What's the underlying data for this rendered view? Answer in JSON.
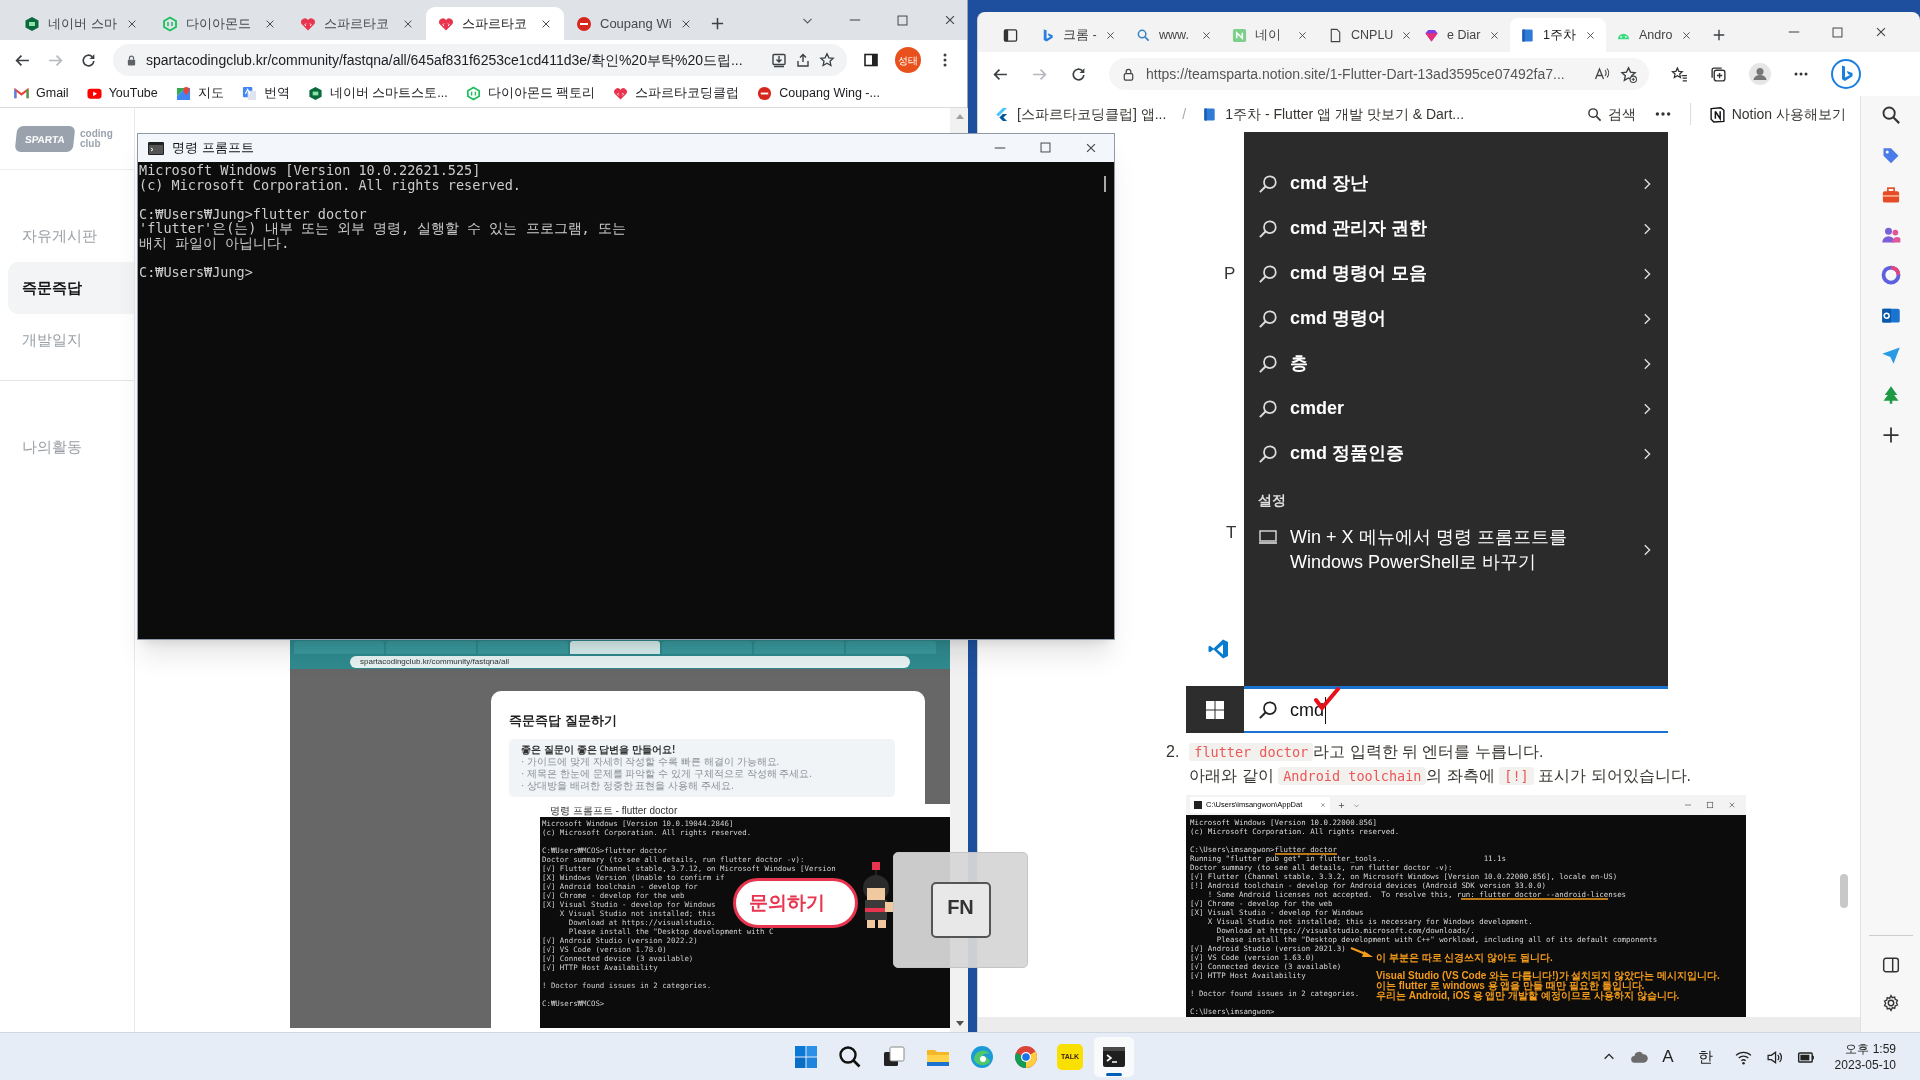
{
  "left_browser": {
    "tabs": [
      {
        "kind": "hexagon",
        "label": "네이버 스마",
        "selected": false
      },
      {
        "kind": "outline",
        "label": "다이아몬드",
        "selected": false
      },
      {
        "kind": "heart",
        "label": "스파르타코",
        "selected": false
      },
      {
        "kind": "heart",
        "label": "스파르타코",
        "selected": true
      },
      {
        "kind": "circle",
        "label": "Coupang Wi",
        "selected": false
      }
    ],
    "url": "spartacodingclub.kr/community/fastqna/all/645af831f6253ce1cd411d3e/확인%20부탁%20드립...",
    "profile": "성태",
    "bookmarks": [
      {
        "kind": "mail",
        "label": "Gmail"
      },
      {
        "kind": "play",
        "label": "YouTube"
      },
      {
        "kind": "pin",
        "label": "지도"
      },
      {
        "kind": "translate",
        "label": "번역"
      },
      {
        "kind": "hexagon",
        "label": "네이버 스마트스토..."
      },
      {
        "kind": "outline",
        "label": "다이아몬드 팩토리"
      },
      {
        "kind": "heart",
        "label": "스파르타코딩클럽"
      },
      {
        "kind": "circle",
        "label": "Coupang Wing -..."
      }
    ],
    "logo": {
      "mark": "SPARTA",
      "wordmark": "coding\nclub"
    },
    "nav": [
      {
        "label": "자유게시판",
        "selected": false
      },
      {
        "label": "즉문즉답",
        "selected": true
      },
      {
        "label": "개발일지",
        "selected": false
      },
      {
        "label": "나의활동",
        "selected": false
      }
    ],
    "post_image": {
      "url": "spartacodingclub.kr/community/fastqna/all",
      "modal_title": "즉문즉답 질문하기",
      "tip_title": "좋은 질문이 좋은 답변을 만들어요!",
      "tips": [
        "· 가이드에 맞게 자세히 작성할 수록 빠른 해결이 가능해요.",
        "· 제목은 한눈에 문제를 파악할 수 있게 구체적으로 작성해 주세요.",
        "· 상대방을 배려한 정중한 표현을 사용해 주세요."
      ],
      "terminal": {
        "title": "명령 프롬프트 - flutter doctor",
        "blocks": [
          [
            "Microsoft Windows [Version 10.0.19044.2846]",
            "(c) Microsoft Corporation. All rights reserved."
          ],
          [
            "C:₩Users₩MCOS>flutter doctor",
            "Doctor summary (to see all details, run flutter doctor -v):",
            "[√] Flutter (Channel stable, 3.7.12, on Microsoft Windows [Version",
            "[X] Windows Version (Unable to confirm if",
            "[√] Android toolchain - develop for",
            "[√] Chrome - develop for the web",
            "[X] Visual Studio - develop for Windows",
            "    X Visual Studio not installed; this",
            "      Download at https://visualstudio.",
            "      Please install the \"Desktop development with C",
            "[√] Android Studio (version 2022.2)",
            "[√] VS Code (version 1.78.0)",
            "[√] Connected device (3 available)",
            "[√] HTTP Host Availability"
          ],
          [
            "! Doctor found issues in 2 categories."
          ],
          [
            "C:₩Users₩MCOS>"
          ]
        ]
      }
    },
    "chat_button": "문의하기"
  },
  "cmd_window": {
    "title": "명령 프롬프트",
    "blocks": [
      [
        "Microsoft Windows [Version 10.0.22621.525]",
        "(c) Microsoft Corporation. All rights reserved."
      ],
      [
        "C:₩Users₩Jung>flutter doctor",
        "'flutter'은(는) 내부 또는 외부 명령, 실행할 수 있는 프로그램, 또는",
        "배치 파일이 아닙니다."
      ],
      [
        "C:₩Users₩Jung>"
      ]
    ]
  },
  "fn_overlay": {
    "key": "FN"
  },
  "edge_browser": {
    "tabs": [
      {
        "kind": "bing",
        "label": "크롬 -",
        "selected": false
      },
      {
        "kind": "search",
        "label": "www.",
        "selected": false
      },
      {
        "kind": "square",
        "label": "네이",
        "selected": false
      },
      {
        "kind": "page",
        "label": "CNPLU",
        "selected": false
      },
      {
        "kind": "gem",
        "label": "e Diar",
        "selected": false
      },
      {
        "kind": "book",
        "label": "1주차",
        "selected": true
      },
      {
        "kind": "android",
        "label": "Andro",
        "selected": false
      }
    ],
    "url": "https://teamsparta.notion.site/1-Flutter-Dart-13ad3595ce07492fa7...",
    "breadcrumbs": [
      "[스파르타코딩클럽] 앱...",
      "1주차 - Flutter 앱 개발 맛보기 & Dart..."
    ],
    "breadcrumb_separator": "/",
    "search": "검색",
    "try_notion": "Notion 사용해보기",
    "start_search_image": {
      "edge_letters": [
        "P",
        "T"
      ],
      "results": [
        "cmd 장난",
        "cmd 관리자 권한",
        "cmd 명령어 모음",
        "cmd 명령어",
        "층",
        "cmder",
        "cmd 정품인증"
      ],
      "section": "설정",
      "setting": "Win + X 메뉴에서 명령 프롬프트를\nWindows PowerShell로 바꾸기",
      "query": "cmd"
    },
    "step": {
      "number": "2.",
      "lines": [
        [
          {
            "kind": "code",
            "text": "flutter doctor"
          },
          {
            "kind": "text",
            "text": "라고 입력한 뒤 엔터를 누릅니다."
          }
        ],
        [
          {
            "kind": "text",
            "text": "아래와 같이 "
          },
          {
            "kind": "code",
            "text": "Android toolchain"
          },
          {
            "kind": "text",
            "text": "의 좌측에 "
          },
          {
            "kind": "code",
            "text": "[!]"
          },
          {
            "kind": "text",
            "text": " 표시가 되어있습니다."
          }
        ]
      ]
    },
    "terminal_image": {
      "tab": "C:\\Users\\imsangwon\\AppDat",
      "blocks": [
        [
          "Microsoft Windows [Version 10.0.22000.856]",
          "(c) Microsoft Corporation. All rights reserved."
        ],
        [
          "C:\\Users\\imsangwon>flutter doctor",
          "Running \"flutter pub get\" in flutter_tools...                     11.1s",
          "Doctor summary (to see all details, run flutter doctor -v):",
          "[√] Flutter (Channel stable, 3.3.2, on Microsoft Windows [Version 10.0.22000.856], locale en-US)",
          "[!] Android toolchain - develop for Android devices (Android SDK version 33.0.0)",
          "    ! Some Android licenses not accepted.  To resolve this, run: flutter doctor --android-licenses",
          "[√] Chrome - develop for the web",
          "[X] Visual Studio - develop for Windows",
          "    X Visual Studio not installed; this is necessary for Windows development.",
          "      Download at https://visualstudio.microsoft.com/downloads/.",
          "      Please install the \"Desktop development with C++\" workload, including all of its default components",
          "[√] Android Studio (version 2021.3)",
          "[√] VS Code (version 1.63.0)",
          "[√] Connected device (3 available)",
          "[√] HTTP Host Availability"
        ],
        [
          "! Doctor found issues in 2 categories."
        ],
        [
          "C:\\Users\\imsangwon>"
        ]
      ],
      "notes": [
        "이 부분은 따로 신경쓰지 않아도 됩니다.",
        "Visual Studio (VS Code 와는 다릅니다!)가 설치되지 않았다는 메시지입니다.",
        "이는 flutter 로 windows 용 앱을 만들 때만 필요한 툴입니다.",
        "우리는 Android, iOS 용 앱만 개발할 예정이므로 사용하지 않습니다."
      ]
    }
  },
  "taskbar": {
    "apps": [
      {
        "kind": "start",
        "selected": false
      },
      {
        "kind": "search",
        "selected": false
      },
      {
        "kind": "taskview",
        "selected": false
      },
      {
        "kind": "folder",
        "selected": false
      },
      {
        "kind": "edge",
        "selected": false
      },
      {
        "kind": "chrome",
        "selected": false
      },
      {
        "kind": "talk",
        "label": "TALK",
        "selected": false
      },
      {
        "kind": "terminal",
        "selected": true
      }
    ],
    "tray": {
      "ime": "A",
      "language": "한",
      "time": "오후 1:59",
      "date": "2023-05-10"
    }
  }
}
